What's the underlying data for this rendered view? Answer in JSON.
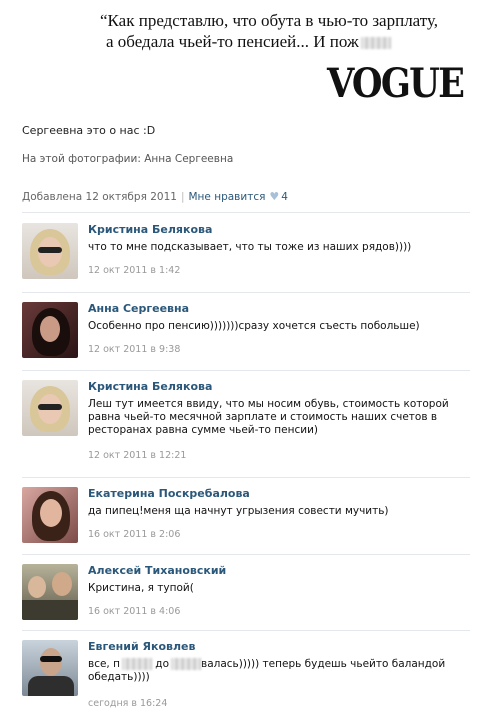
{
  "quote": {
    "line1": "“Как представлю, что обута в чью-то зарплату,",
    "line2": "а обедала чьей-то пенсией... И пож"
  },
  "logo": {
    "text": "VOGUE"
  },
  "photo": {
    "caption": "Сергеевна это о нас :D",
    "tagged": "На этой фотографии: Анна Сергеевна",
    "added": "Добавлена 12 октября 2011",
    "like_label": "Мне нравится",
    "like_count": "4",
    "like_icon": "heart-icon"
  },
  "comments": [
    {
      "author": "Кристина Белякова",
      "text": "что то мне подсказывает, что ты тоже из наших рядов))))",
      "date": "12 окт 2011 в 1:42"
    },
    {
      "author": "Анна Сергеевна",
      "text": "Особенно про пенсию)))))))сразу хочется съесть побольше)",
      "date": "12 окт 2011 в 9:38"
    },
    {
      "author": "Кристина Белякова",
      "text": "Леш тут имеется ввиду, что мы носим обувь, стоимость которой равна чьей-то месячной зарплате и стоимость наших счетов в ресторанах равна сумме чьей-то пенсии)",
      "date": "12 окт 2011 в 12:21"
    },
    {
      "author": "Екатерина Поскребалова",
      "text": "да пипец!меня ща начнут угрызения совести мучить)",
      "date": "16 окт 2011 в 2:06"
    },
    {
      "author": "Алексей Тихановский",
      "text": "Кристина, я тупой(",
      "date": "16 окт 2011 в 4:06"
    },
    {
      "author": "Евгений Яковлев",
      "text_part1": "все, п",
      "text_part2": " до",
      "text_part3": "валась))))) теперь будешь чьейто баландой обедать))))",
      "date": "сегодня в 16:24"
    }
  ],
  "colors": {
    "link": "#2b587a",
    "meta": "#999999",
    "divider": "#e4e8ed"
  }
}
